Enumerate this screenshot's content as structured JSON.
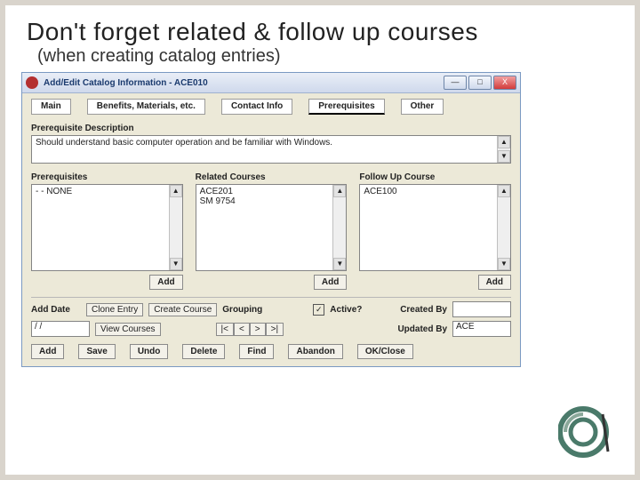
{
  "slide": {
    "title": "Don't forget related & follow up courses",
    "subtitle": "(when creating catalog entries)"
  },
  "window": {
    "title": "Add/Edit Catalog Information - ACE010",
    "controls": {
      "min": "—",
      "max": "□",
      "close": "X"
    },
    "tabs": [
      "Main",
      "Benefits, Materials, etc.",
      "Contact Info",
      "Prerequisites",
      "Other"
    ],
    "active_tab_index": 3
  },
  "prereq": {
    "desc_label": "Prerequisite Description",
    "desc_value": "Should understand basic computer operation and be familiar with Windows."
  },
  "lists": {
    "prerequisites": {
      "label": "Prerequisites",
      "items": [
        "- - NONE"
      ],
      "add": "Add"
    },
    "related": {
      "label": "Related Courses",
      "items": [
        "ACE201",
        "SM 9754"
      ],
      "add": "Add"
    },
    "followup": {
      "label": "Follow Up Course",
      "items": [
        "ACE100"
      ],
      "add": "Add"
    }
  },
  "footer": {
    "row1": [
      "Add Date",
      "Clone Entry",
      "Create Course",
      "Grouping"
    ],
    "active_label": "Active?",
    "active_checked": "✓",
    "created_by_label": "Created By",
    "date_value": "/ /",
    "view_courses": "View Courses",
    "nav": [
      "|<",
      "<",
      ">",
      ">|"
    ],
    "updated_by_label": "Updated By",
    "updated_by_value": "ACE",
    "row3": [
      "Add",
      "Save",
      "Undo",
      "Delete",
      "Find",
      "Abandon",
      "OK/Close"
    ]
  }
}
